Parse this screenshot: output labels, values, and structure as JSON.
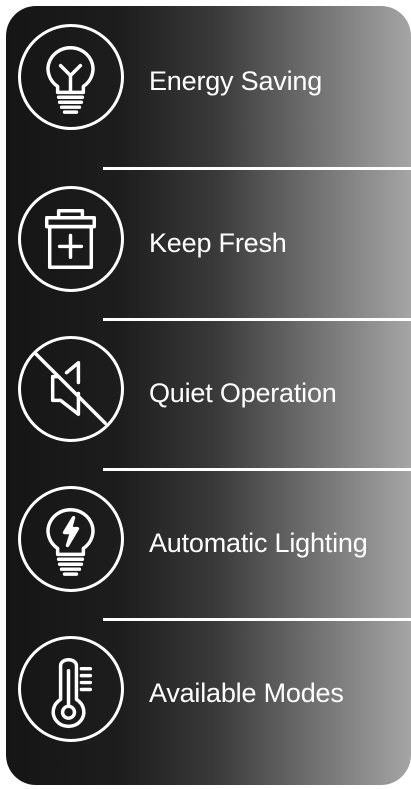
{
  "features": [
    {
      "label": "Energy Saving",
      "icon": "light-bulb-icon"
    },
    {
      "label": "Keep Fresh",
      "icon": "first-aid-box-icon"
    },
    {
      "label": "Quiet Operation",
      "icon": "speaker-muted-icon"
    },
    {
      "label": "Automatic Lighting",
      "icon": "lightning-bulb-icon"
    },
    {
      "label": "Available Modes",
      "icon": "thermometer-icon"
    }
  ],
  "colors": {
    "foreground": "#ffffff",
    "panel_dark": "#151515",
    "panel_light": "#a5a5a5"
  }
}
